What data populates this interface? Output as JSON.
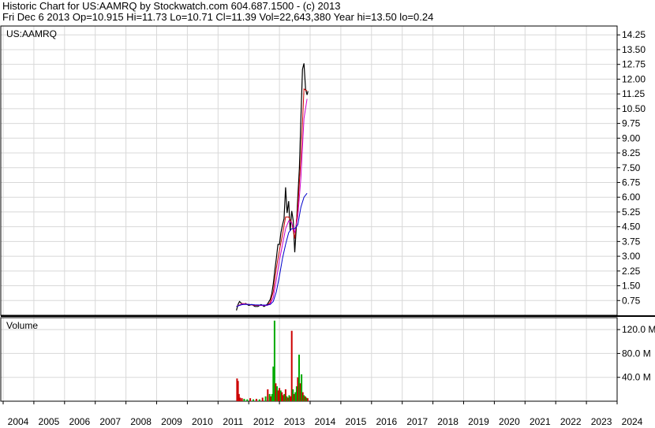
{
  "header": {
    "line1": "Historic Chart for US:AAMRQ by Stockwatch.com 604.687.1500 - (c) 2013",
    "line2": "Fri Dec  6 2013   Op=10.915   Hi=11.73   Lo=10.71   Cl=11.39   Vol=22,643,380   Year hi=13.50   lo=0.24"
  },
  "chart_data": [
    {
      "type": "line",
      "title": "US:AAMRQ",
      "xlabel": "",
      "ylabel": "",
      "x_range": [
        2004.0,
        2024.0
      ],
      "ylim": [
        0,
        14.7
      ],
      "y_ticks": [
        "14.25",
        "13.50",
        "12.75",
        "12.00",
        "11.25",
        "10.50",
        "9.75",
        "9.00",
        "8.25",
        "7.50",
        "6.75",
        "6.00",
        "5.25",
        "4.50",
        "3.75",
        "3.00",
        "2.25",
        "1.50",
        "0.75"
      ],
      "grid": true,
      "colors": {
        "price": "#000000",
        "ma_short": "#cc0000",
        "ma_mid": "#cc00cc",
        "ma_long": "#0000cc"
      },
      "series": [
        {
          "x": [
            2011.6,
            2011.65,
            2011.7,
            2011.8,
            2011.9,
            2012.0,
            2012.1,
            2012.2,
            2012.3,
            2012.4,
            2012.5,
            2012.6,
            2012.7,
            2012.75,
            2012.8,
            2012.85,
            2012.9,
            2012.95,
            2013.0,
            2013.05,
            2013.1,
            2013.15,
            2013.2,
            2013.25,
            2013.3,
            2013.35,
            2013.4,
            2013.45,
            2013.5,
            2013.55,
            2013.6,
            2013.65,
            2013.7,
            2013.75,
            2013.8,
            2013.85,
            2013.9,
            2013.93
          ],
          "y": [
            0.25,
            0.55,
            0.7,
            0.55,
            0.6,
            0.5,
            0.55,
            0.45,
            0.45,
            0.55,
            0.45,
            0.55,
            0.8,
            1.1,
            1.6,
            2.3,
            2.9,
            3.6,
            3.6,
            4.2,
            4.6,
            4.9,
            6.5,
            5.2,
            5.8,
            4.3,
            5.3,
            4.8,
            3.2,
            4.5,
            6.0,
            7.5,
            10.0,
            12.5,
            12.8,
            11.5,
            11.2,
            11.39
          ]
        },
        {
          "x": [
            2011.6,
            2011.8,
            2012.0,
            2012.2,
            2012.4,
            2012.6,
            2012.7,
            2012.8,
            2012.9,
            2013.0,
            2013.1,
            2013.2,
            2013.3,
            2013.4,
            2013.5,
            2013.6,
            2013.7,
            2013.8,
            2013.9
          ],
          "y": [
            0.45,
            0.6,
            0.55,
            0.5,
            0.5,
            0.52,
            0.65,
            1.2,
            2.4,
            3.3,
            4.1,
            5.0,
            5.0,
            4.7,
            3.9,
            5.5,
            8.0,
            11.5,
            11.4
          ]
        },
        {
          "x": [
            2011.6,
            2011.8,
            2012.0,
            2012.2,
            2012.4,
            2012.6,
            2012.7,
            2012.8,
            2012.9,
            2013.0,
            2013.1,
            2013.2,
            2013.3,
            2013.4,
            2013.5,
            2013.6,
            2013.7,
            2013.8,
            2013.9
          ],
          "y": [
            0.45,
            0.58,
            0.55,
            0.52,
            0.5,
            0.5,
            0.58,
            0.9,
            1.8,
            2.8,
            3.6,
            4.4,
            4.8,
            4.7,
            4.2,
            5.0,
            7.0,
            10.0,
            11.0
          ]
        },
        {
          "x": [
            2011.6,
            2011.8,
            2012.0,
            2012.2,
            2012.4,
            2012.6,
            2012.7,
            2012.8,
            2012.9,
            2013.0,
            2013.1,
            2013.2,
            2013.3,
            2013.4,
            2013.5,
            2013.6,
            2013.7,
            2013.8,
            2013.9
          ],
          "y": [
            0.45,
            0.55,
            0.55,
            0.53,
            0.52,
            0.52,
            0.55,
            0.7,
            1.2,
            2.0,
            2.9,
            3.6,
            4.2,
            4.4,
            4.4,
            4.6,
            5.5,
            6.0,
            6.2
          ]
        }
      ]
    },
    {
      "type": "bar",
      "title": "Volume",
      "xlabel": "",
      "ylabel": "",
      "ylim": [
        0,
        140
      ],
      "y_ticks": [
        "120.0 M",
        "80.0 M",
        "40.0 M"
      ],
      "colors": {
        "up": "#00aa00",
        "down": "#cc0000"
      },
      "x": [
        2011.62,
        2011.65,
        2011.68,
        2011.72,
        2011.78,
        2011.85,
        2011.95,
        2012.05,
        2012.15,
        2012.25,
        2012.35,
        2012.45,
        2012.55,
        2012.62,
        2012.68,
        2012.72,
        2012.76,
        2012.8,
        2012.84,
        2012.88,
        2012.92,
        2012.96,
        2013.0,
        2013.04,
        2013.08,
        2013.12,
        2013.16,
        2013.2,
        2013.24,
        2013.28,
        2013.32,
        2013.36,
        2013.4,
        2013.44,
        2013.48,
        2013.52,
        2013.56,
        2013.6,
        2013.64,
        2013.68,
        2013.72,
        2013.76,
        2013.8,
        2013.84,
        2013.88,
        2013.92
      ],
      "values": [
        38,
        34,
        12,
        6,
        5,
        4,
        3,
        5,
        3,
        4,
        3,
        6,
        8,
        20,
        12,
        8,
        12,
        58,
        135,
        30,
        25,
        18,
        22,
        18,
        15,
        10,
        12,
        20,
        8,
        6,
        10,
        8,
        118,
        20,
        12,
        15,
        25,
        40,
        78,
        30,
        45,
        15,
        10,
        8,
        6,
        5
      ],
      "direction": [
        "down",
        "down",
        "down",
        "down",
        "down",
        "up",
        "up",
        "down",
        "up",
        "down",
        "up",
        "down",
        "up",
        "down",
        "up",
        "down",
        "up",
        "up",
        "up",
        "down",
        "up",
        "down",
        "down",
        "up",
        "down",
        "down",
        "up",
        "down",
        "up",
        "down",
        "up",
        "down",
        "down",
        "up",
        "down",
        "up",
        "up",
        "down",
        "up",
        "down",
        "up",
        "down",
        "up",
        "down",
        "up",
        "down"
      ]
    }
  ],
  "x_axis": {
    "labels": [
      "2004",
      "2005",
      "2006",
      "2007",
      "2008",
      "2009",
      "2010",
      "2011",
      "2012",
      "2013",
      "2014",
      "2015",
      "2016",
      "2017",
      "2018",
      "2019",
      "2020",
      "2021",
      "2022",
      "2023",
      "2024"
    ]
  }
}
